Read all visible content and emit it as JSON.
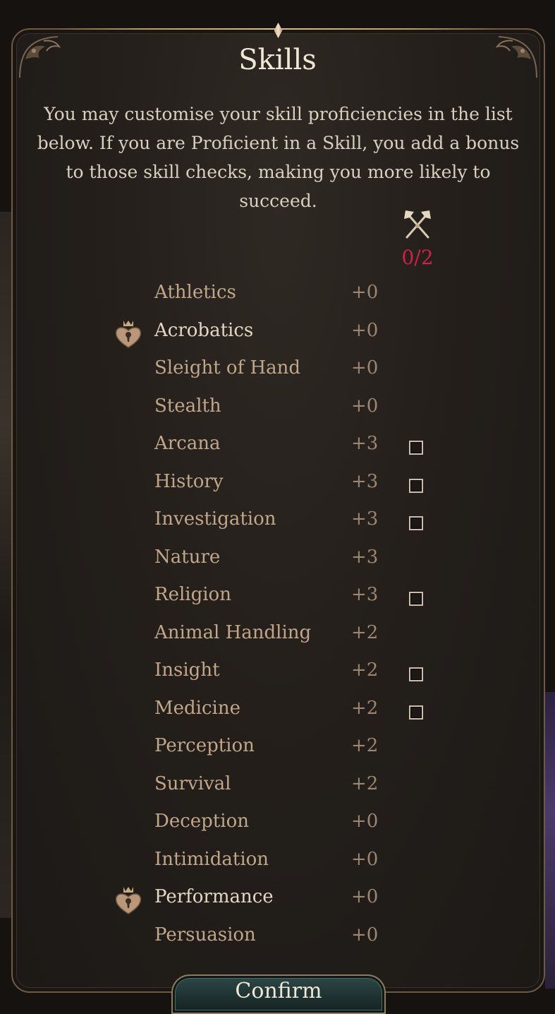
{
  "window": {
    "title": "Skills"
  },
  "description": "You may customise your skill proficiencies in the list below. If you are Proficient in a Skill, you add a bonus to those skill checks, making you more likely to succeed.",
  "counter": {
    "text": "0/2",
    "color": "#d21f47"
  },
  "header_icon": "crossed-axes-icon",
  "skills": [
    {
      "name": "Athletics",
      "bonus": "+0",
      "checkbox": false,
      "granted": false
    },
    {
      "name": "Acrobatics",
      "bonus": "+0",
      "checkbox": false,
      "granted": true
    },
    {
      "name": "Sleight of Hand",
      "bonus": "+0",
      "checkbox": false,
      "granted": false
    },
    {
      "name": "Stealth",
      "bonus": "+0",
      "checkbox": false,
      "granted": false
    },
    {
      "name": "Arcana",
      "bonus": "+3",
      "checkbox": true,
      "granted": false
    },
    {
      "name": "History",
      "bonus": "+3",
      "checkbox": true,
      "granted": false
    },
    {
      "name": "Investigation",
      "bonus": "+3",
      "checkbox": true,
      "granted": false
    },
    {
      "name": "Nature",
      "bonus": "+3",
      "checkbox": false,
      "granted": false
    },
    {
      "name": "Religion",
      "bonus": "+3",
      "checkbox": true,
      "granted": false
    },
    {
      "name": "Animal Handling",
      "bonus": "+2",
      "checkbox": false,
      "granted": false
    },
    {
      "name": "Insight",
      "bonus": "+2",
      "checkbox": true,
      "granted": false
    },
    {
      "name": "Medicine",
      "bonus": "+2",
      "checkbox": true,
      "granted": false
    },
    {
      "name": "Perception",
      "bonus": "+2",
      "checkbox": false,
      "granted": false
    },
    {
      "name": "Survival",
      "bonus": "+2",
      "checkbox": false,
      "granted": false
    },
    {
      "name": "Deception",
      "bonus": "+0",
      "checkbox": false,
      "granted": false
    },
    {
      "name": "Intimidation",
      "bonus": "+0",
      "checkbox": false,
      "granted": false
    },
    {
      "name": "Performance",
      "bonus": "+0",
      "checkbox": false,
      "granted": true
    },
    {
      "name": "Persuasion",
      "bonus": "+0",
      "checkbox": false,
      "granted": false
    }
  ],
  "granted_badge_icon": "heart-lock-badge-icon",
  "confirm": {
    "label": "Confirm"
  },
  "colors": {
    "accent_red": "#d21f47",
    "skill_text": "#c1a689",
    "panel_border": "#6e5a45"
  }
}
